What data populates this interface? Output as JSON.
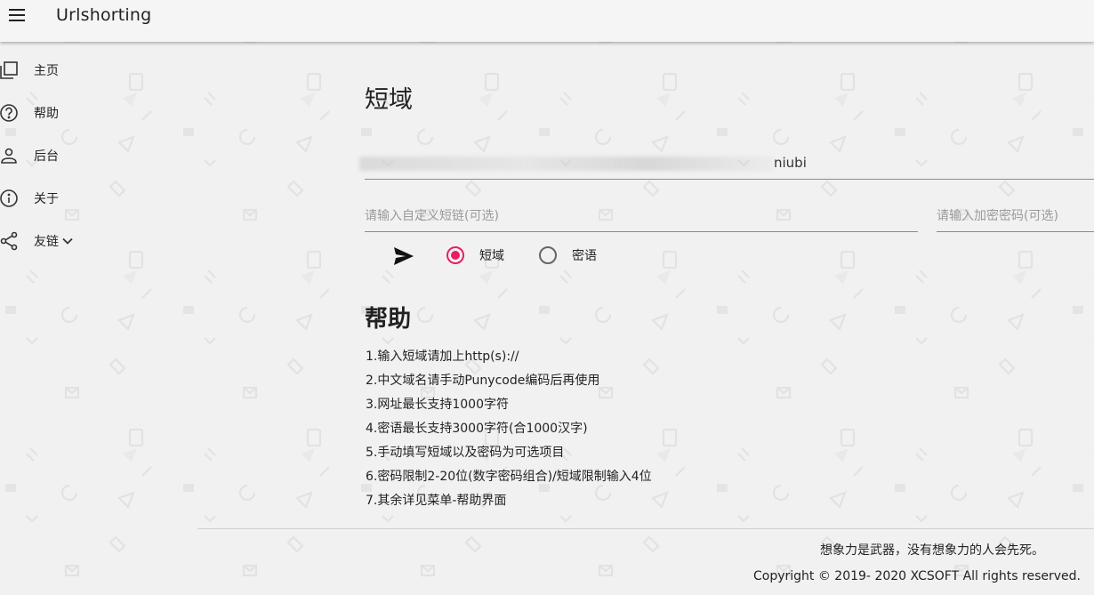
{
  "app": {
    "title": "Urlshorting"
  },
  "sidebar": {
    "items": [
      {
        "label": "主页"
      },
      {
        "label": "帮助"
      },
      {
        "label": "后台"
      },
      {
        "label": "关于"
      },
      {
        "label": "友链"
      }
    ]
  },
  "main": {
    "title": "短域",
    "url_value": "niubi",
    "custom_placeholder": "请输入自定义短链(可选)",
    "password_placeholder": "请输入加密密码(可选)",
    "radios": [
      {
        "label": "短域",
        "checked": true
      },
      {
        "label": "密语",
        "checked": false
      }
    ]
  },
  "help": {
    "title": "帮助",
    "items": [
      "1.输入短域请加上http(s)://",
      "2.中文域名请手动Punycode编码后再使用",
      "3.网址最长支持1000字符",
      "4.密语最长支持3000字符(合1000汉字)",
      "5.手动填写短域以及密码为可选项目",
      "6.密码限制2-20位(数字密码组合)/短域限制输入4位",
      "7.其余详见菜单-帮助界面"
    ]
  },
  "footer": {
    "motto": "想象力是武器，没有想象力的人会先死。",
    "copyright": "Copyright © 2019- 2020 XCSOFT All rights reserved."
  },
  "colors": {
    "accent": "#e91e63",
    "background": "#f1f1f1"
  }
}
